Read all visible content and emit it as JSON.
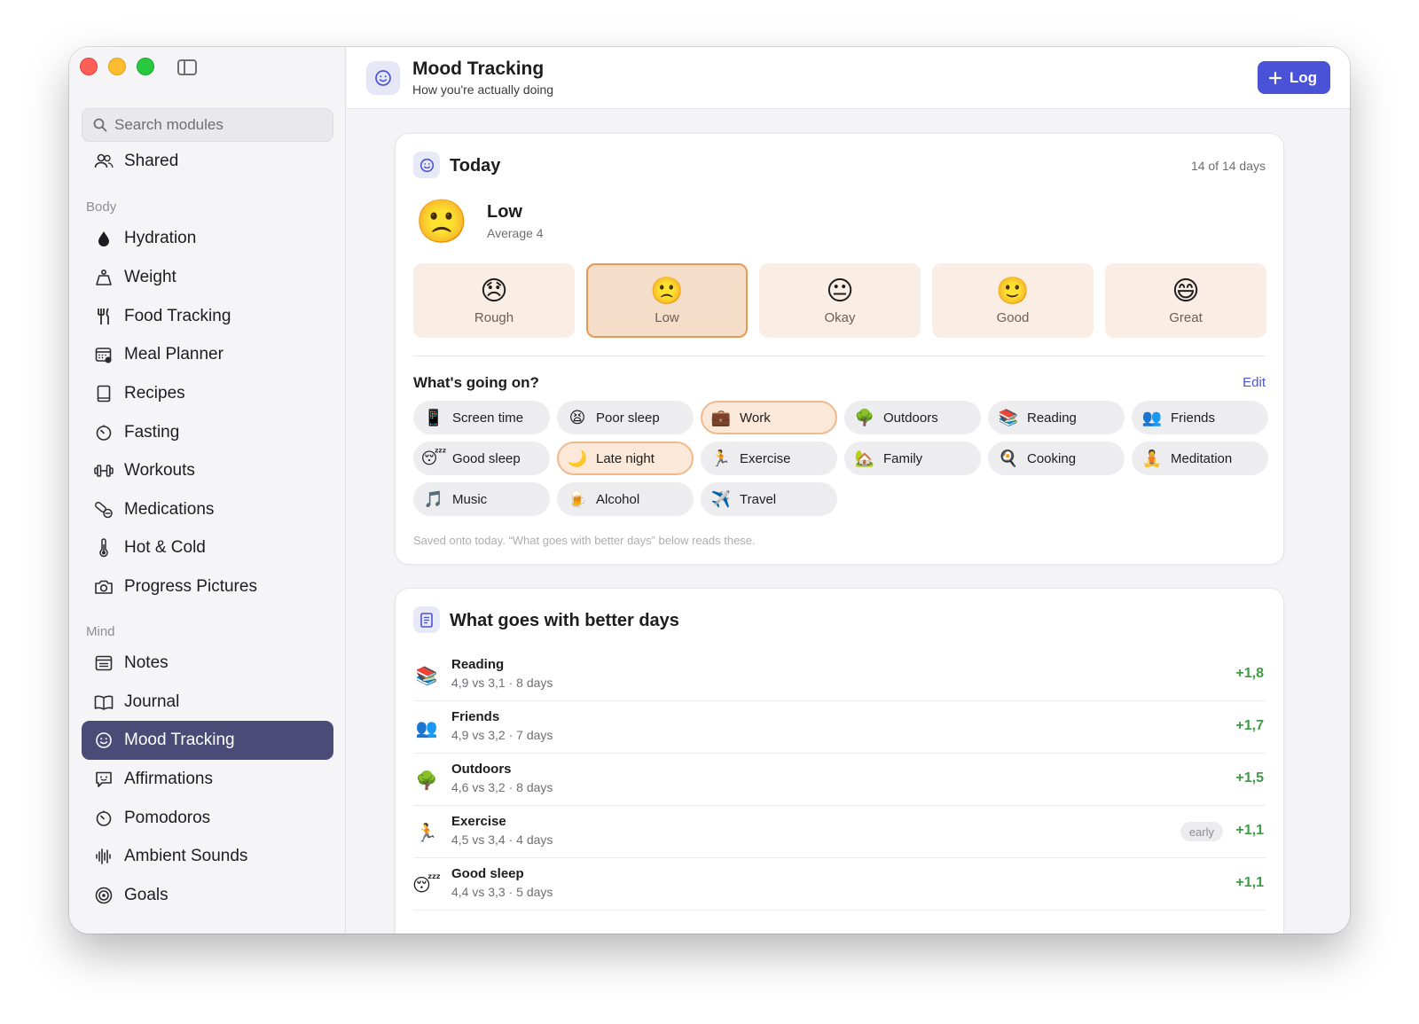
{
  "window": {
    "controls": [
      "close",
      "minimize",
      "zoom"
    ]
  },
  "sidebar": {
    "search_placeholder": "Search modules",
    "shared_label": "Shared",
    "sections": [
      {
        "label": "Body",
        "items": [
          {
            "label": "Hydration",
            "icon": "droplet-icon"
          },
          {
            "label": "Weight",
            "icon": "scale-icon"
          },
          {
            "label": "Food Tracking",
            "icon": "fork-knife-icon"
          },
          {
            "label": "Meal Planner",
            "icon": "calendar-icon"
          },
          {
            "label": "Recipes",
            "icon": "book-icon"
          },
          {
            "label": "Fasting",
            "icon": "timer-icon"
          },
          {
            "label": "Workouts",
            "icon": "dumbbell-icon"
          },
          {
            "label": "Medications",
            "icon": "pills-icon"
          },
          {
            "label": "Hot & Cold",
            "icon": "thermometer-icon"
          },
          {
            "label": "Progress Pictures",
            "icon": "camera-icon"
          }
        ]
      },
      {
        "label": "Mind",
        "items": [
          {
            "label": "Notes",
            "icon": "notes-icon"
          },
          {
            "label": "Journal",
            "icon": "open-book-icon"
          },
          {
            "label": "Mood Tracking",
            "icon": "smiley-icon",
            "active": true
          },
          {
            "label": "Affirmations",
            "icon": "speech-bubble-icon"
          },
          {
            "label": "Pomodoros",
            "icon": "timer-icon"
          },
          {
            "label": "Ambient Sounds",
            "icon": "waveform-icon"
          },
          {
            "label": "Goals",
            "icon": "target-icon"
          }
        ]
      }
    ]
  },
  "header": {
    "title": "Mood Tracking",
    "subtitle": "How you're actually doing",
    "log_label": "Log"
  },
  "today": {
    "title": "Today",
    "days_count": "14 of 14 days",
    "current_mood": "Low",
    "average": "Average 4",
    "moods": [
      {
        "label": "Rough",
        "emoji": "😞"
      },
      {
        "label": "Low",
        "emoji": "🙁",
        "selected": true
      },
      {
        "label": "Okay",
        "emoji": "😐"
      },
      {
        "label": "Good",
        "emoji": "🙂"
      },
      {
        "label": "Great",
        "emoji": "😄"
      }
    ],
    "current_emoji": "🙁",
    "factors_title": "What's going on?",
    "edit_label": "Edit",
    "factors": [
      {
        "label": "Screen time",
        "emoji": "📱"
      },
      {
        "label": "Poor sleep",
        "emoji": "😫"
      },
      {
        "label": "Work",
        "emoji": "💼",
        "selected": true
      },
      {
        "label": "Outdoors",
        "emoji": "🌳"
      },
      {
        "label": "Reading",
        "emoji": "📚"
      },
      {
        "label": "Friends",
        "emoji": "👥"
      },
      {
        "label": "Good sleep",
        "emoji": "😴"
      },
      {
        "label": "Late night",
        "emoji": "🌙",
        "selected": true
      },
      {
        "label": "Exercise",
        "emoji": "🏃"
      },
      {
        "label": "Family",
        "emoji": "🏡"
      },
      {
        "label": "Cooking",
        "emoji": "🍳"
      },
      {
        "label": "Meditation",
        "emoji": "🧘"
      },
      {
        "label": "Music",
        "emoji": "🎵"
      },
      {
        "label": "Alcohol",
        "emoji": "🍺"
      },
      {
        "label": "Travel",
        "emoji": "✈️"
      }
    ],
    "footnote": "Saved onto today. “What goes with better days” below reads these."
  },
  "better_days": {
    "title": "What goes with better days",
    "rows": [
      {
        "name": "Reading",
        "detail": "4,9 vs 3,1 · 8 days",
        "delta": "+1,8",
        "emoji": "📚"
      },
      {
        "name": "Friends",
        "detail": "4,9 vs 3,2 · 7 days",
        "delta": "+1,7",
        "emoji": "👥"
      },
      {
        "name": "Outdoors",
        "detail": "4,6 vs 3,2 · 8 days",
        "delta": "+1,5",
        "emoji": "🌳"
      },
      {
        "name": "Exercise",
        "detail": "4,5 vs 3,4 · 4 days",
        "delta": "+1,1",
        "emoji": "🏃",
        "badge": "early"
      },
      {
        "name": "Good sleep",
        "detail": "4,4 vs 3,3 · 5 days",
        "delta": "+1,1",
        "emoji": "😴"
      }
    ]
  },
  "colors": {
    "accent": "#4a52d8",
    "sidebar_active": "#4b4b78",
    "positive": "#3f9a44",
    "mood_tile": "#faeee4",
    "mood_selected_border": "#e89853"
  }
}
